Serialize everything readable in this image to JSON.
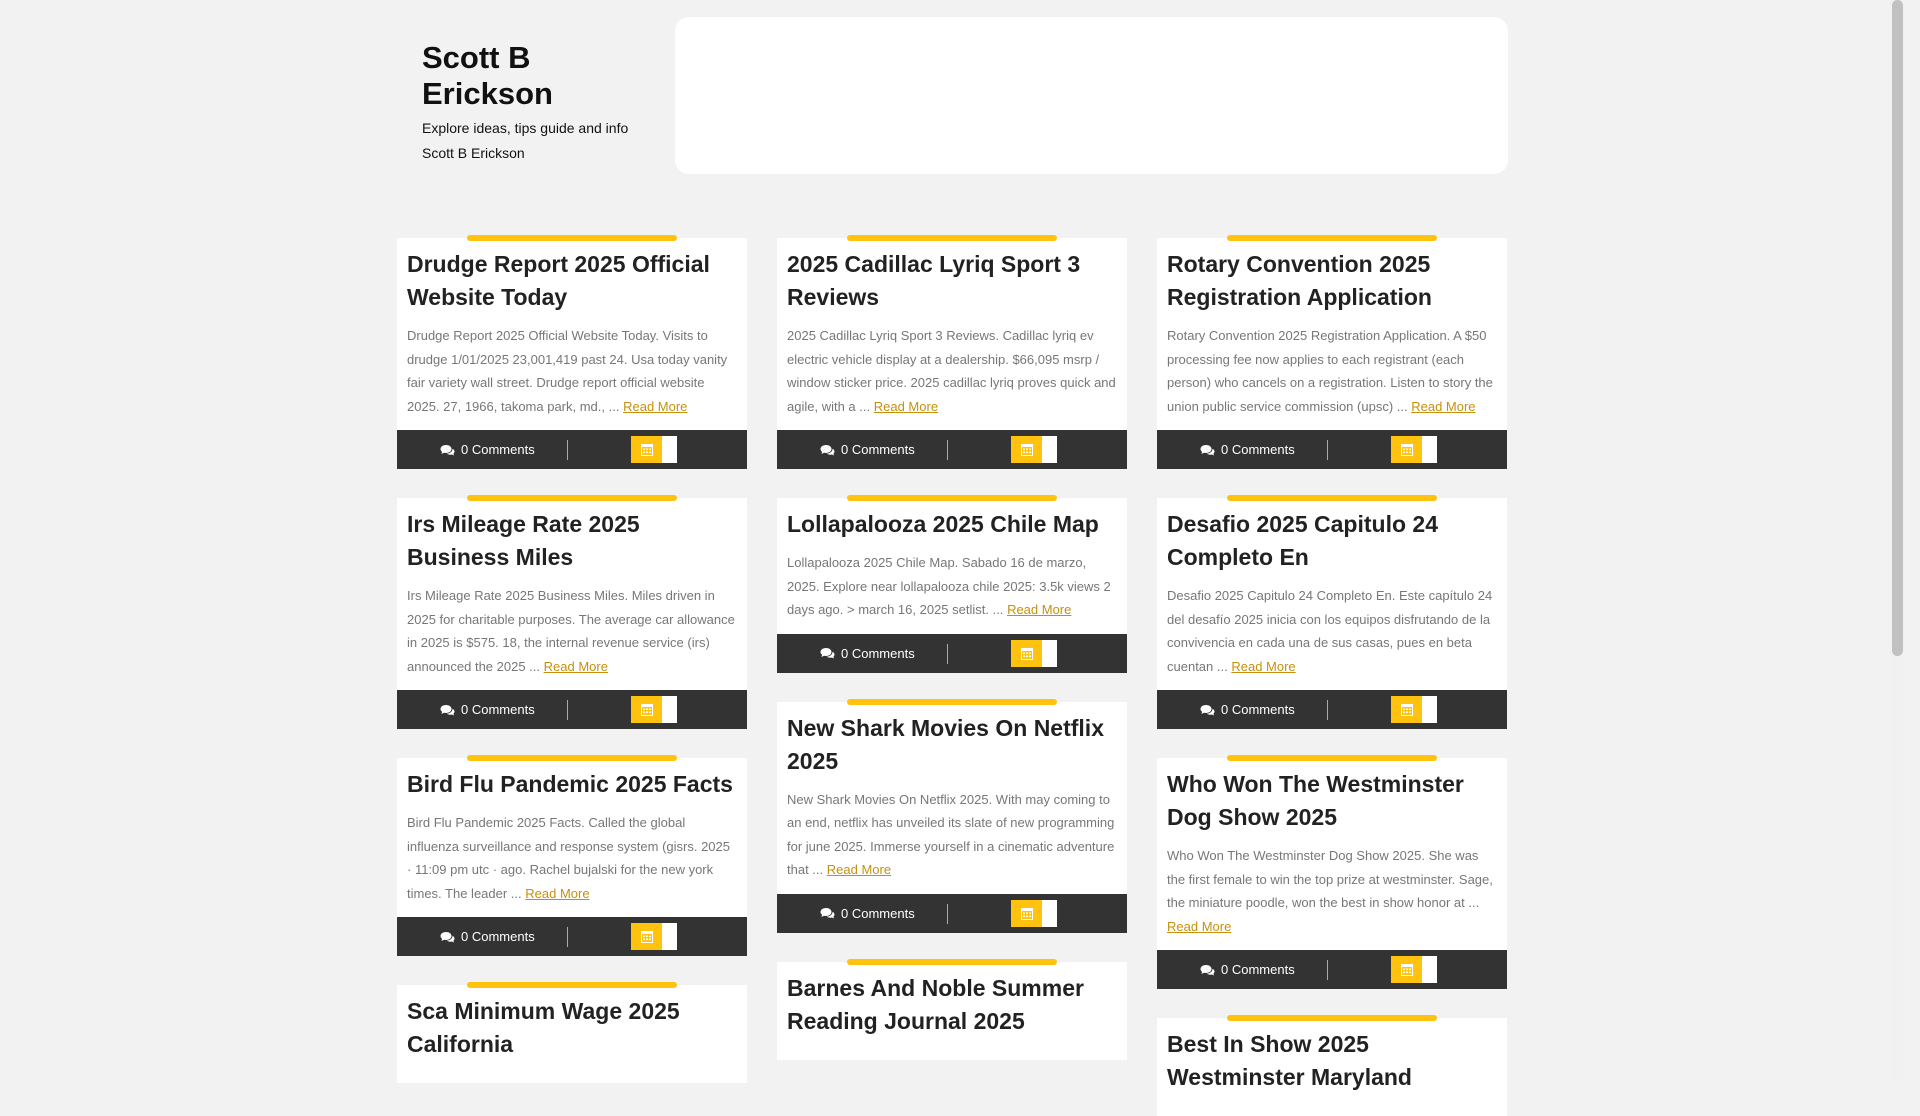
{
  "site": {
    "title": "Scott B Erickson",
    "description": "Explore ideas, tips guide and info Scott B Erickson"
  },
  "colors": {
    "accent": "#ffc20e",
    "footer": "#333333",
    "background": "#f2f2f2"
  },
  "icons": {
    "comments": "comments-icon",
    "calendar": "calendar-icon"
  },
  "columns": [
    {
      "cards": [
        {
          "title": "Drudge Report 2025 Official Website Today",
          "excerpt": "Drudge Report 2025 Official Website Today. Visits to drudge 1/01/2025 23,001,419 past 24. Usa today vanity fair variety wall street. Drudge report official website 2025. 27, 1966, takoma park, md., ...",
          "read_more": "Read More",
          "comments": "0 Comments"
        },
        {
          "title": "Irs Mileage Rate 2025 Business Miles",
          "excerpt": "Irs Mileage Rate 2025 Business Miles. Miles driven in 2025 for charitable purposes. The average car allowance in 2025 is $575. 18, the internal revenue service (irs) announced the 2025 ...",
          "read_more": "Read More",
          "comments": "0 Comments"
        },
        {
          "title": "Bird Flu Pandemic 2025 Facts",
          "excerpt": "Bird Flu Pandemic 2025 Facts. Called the global influenza surveillance and response system (gisrs. 2025 · 11:09 pm utc · ago. Rachel bujalski for the new york times. The leader ...",
          "read_more": "Read More",
          "comments": "0 Comments"
        },
        {
          "title": "Sca Minimum Wage 2025 California",
          "excerpt": "",
          "read_more": "",
          "comments": ""
        }
      ]
    },
    {
      "cards": [
        {
          "title": "2025 Cadillac Lyriq Sport 3 Reviews",
          "excerpt": "2025 Cadillac Lyriq Sport 3 Reviews. Cadillac lyriq ev electric vehicle display at a dealership. $66,095 msrp / window sticker price. 2025 cadillac lyriq proves quick and agile, with a ...",
          "read_more": "Read More",
          "comments": "0 Comments"
        },
        {
          "title": "Lollapalooza 2025 Chile Map",
          "excerpt": "Lollapalooza 2025 Chile Map. Sabado 16 de marzo, 2025. Explore near lollapalooza chile 2025: 3.5k views 2 days ago. > march 16, 2025 setlist. ...",
          "read_more": "Read More",
          "comments": "0 Comments"
        },
        {
          "title": "New Shark Movies On Netflix 2025",
          "excerpt": "New Shark Movies On Netflix 2025. With may coming to an end, netflix has unveiled its slate of new programming for june 2025. Immerse yourself in a cinematic adventure that ...",
          "read_more": "Read More",
          "comments": "0 Comments"
        },
        {
          "title": "Barnes And Noble Summer Reading Journal 2025",
          "excerpt": "",
          "read_more": "",
          "comments": ""
        }
      ]
    },
    {
      "cards": [
        {
          "title": "Rotary Convention 2025 Registration Application",
          "excerpt": "Rotary Convention 2025 Registration Application. A $50 processing fee now applies to each registrant (each person) who cancels on a registration. Listen to story the union public service commission (upsc) ...",
          "read_more": "Read More",
          "comments": "0 Comments"
        },
        {
          "title": "Desafio 2025 Capitulo 24 Completo En",
          "excerpt": "Desafio 2025 Capitulo 24 Completo En. Este capítulo 24 del desafío 2025 inicia con los equipos disfrutando de la convivencia en cada una de sus casas, pues en beta cuentan ...",
          "read_more": "Read More",
          "comments": "0 Comments"
        },
        {
          "title": "Who Won The Westminster Dog Show 2025",
          "excerpt": "Who Won The Westminster Dog Show 2025. She was the first female to win the top prize at westminster. Sage, the miniature poodle, won the best in show honor at ...",
          "read_more": "Read More",
          "comments": "0 Comments"
        },
        {
          "title": "Best In Show 2025 Westminster Maryland",
          "excerpt": "",
          "read_more": "",
          "comments": ""
        }
      ]
    }
  ]
}
